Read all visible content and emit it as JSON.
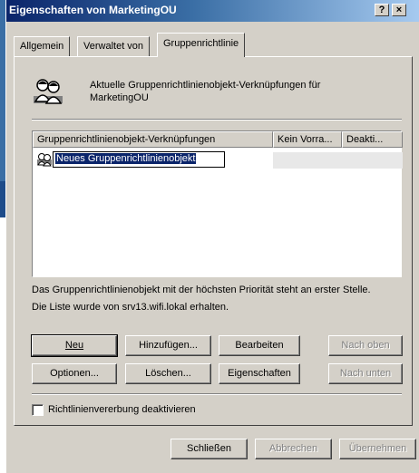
{
  "window": {
    "title": "Eigenschaften von MarketingOU",
    "help_button": "?",
    "close_button": "×"
  },
  "tabs": [
    {
      "label": "Allgemein",
      "active": false
    },
    {
      "label": "Verwaltet von",
      "active": false
    },
    {
      "label": "Gruppenrichtlinie",
      "active": true
    }
  ],
  "header": {
    "icon": "group-policy-icon",
    "line1": "Aktuelle Gruppenrichtlinienobjekt-Verknüpfungen für",
    "line2": "MarketingOU"
  },
  "list": {
    "columns": [
      "Gruppenrichtlinienobjekt-Verknüpfungen",
      "Kein Vorra...",
      "Deakti..."
    ],
    "rows": [
      {
        "name": "Neues Gruppenrichtlinienobjekt",
        "icon": "gpo-link-icon",
        "editing": true
      }
    ]
  },
  "info": {
    "line1": "Das Gruppenrichtlinienobjekt mit der höchsten Priorität steht an erster Stelle.",
    "line2": "Die Liste wurde von srv13.wifi.lokal erhalten."
  },
  "buttons": {
    "new": "Neu",
    "add": "Hinzufügen...",
    "edit": "Bearbeiten",
    "up": "Nach oben",
    "options": "Optionen...",
    "delete": "Löschen...",
    "properties": "Eigenschaften",
    "down": "Nach unten"
  },
  "checkbox": {
    "label": "Richtlinienvererbung deaktivieren",
    "checked": false
  },
  "footer": {
    "close": "Schließen",
    "cancel": "Abbrechen",
    "apply": "Übernehmen"
  }
}
